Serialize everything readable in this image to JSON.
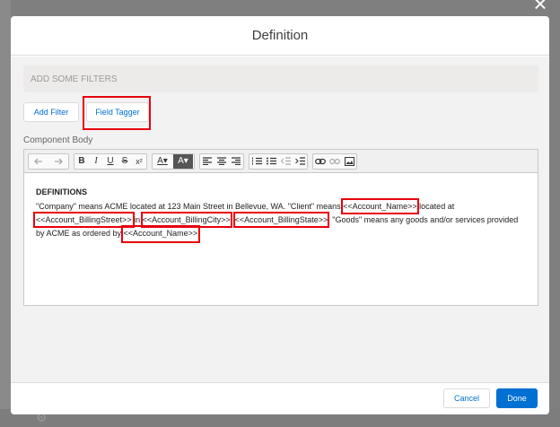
{
  "modal": {
    "title": "Definition",
    "close_glyph": "×"
  },
  "filters": {
    "placeholder": "ADD SOME FILTERS"
  },
  "buttons": {
    "add_filter": "Add Filter",
    "field_tagger": "Field Tagger"
  },
  "component_body_label": "Component Body",
  "toolbar": {
    "icons": [
      "undo-icon",
      "redo-icon",
      "bold-icon",
      "italic-icon",
      "underline-icon",
      "strikethrough-icon",
      "superscript-icon",
      "text-color-icon",
      "background-color-icon",
      "align-left-icon",
      "align-center-icon",
      "align-right-icon",
      "numbered-list-icon",
      "bulleted-list-icon",
      "outdent-icon",
      "indent-icon",
      "link-icon",
      "unlink-icon",
      "image-icon"
    ],
    "bold": "B",
    "italic": "I",
    "underline": "U",
    "strike": "S",
    "superscript": "x²",
    "text_color": "A▾",
    "bg_color": "A▾"
  },
  "document": {
    "heading": "DEFINITIONS",
    "t1": "\"Company\" means ACME located at 123 Main Street in Bellevue, WA. \"Client\" means ",
    "m1": "<<Account_Name>>",
    "t2": " located at ",
    "m2": "<<Account_BillingStreet>>",
    "t3": " in ",
    "m3": "<<Account_BillingCity>>",
    "t4": ", ",
    "m4": "<<Account_BillingState>>",
    "t5": ". \"Goods\" means any goods and/or services provided by ACME as ordered by ",
    "m5": "<<Account_Name>>",
    "t6": "."
  },
  "footer": {
    "cancel": "Cancel",
    "done": "Done"
  },
  "colors": {
    "primary": "#0070d2",
    "highlight": "#e8000c"
  }
}
